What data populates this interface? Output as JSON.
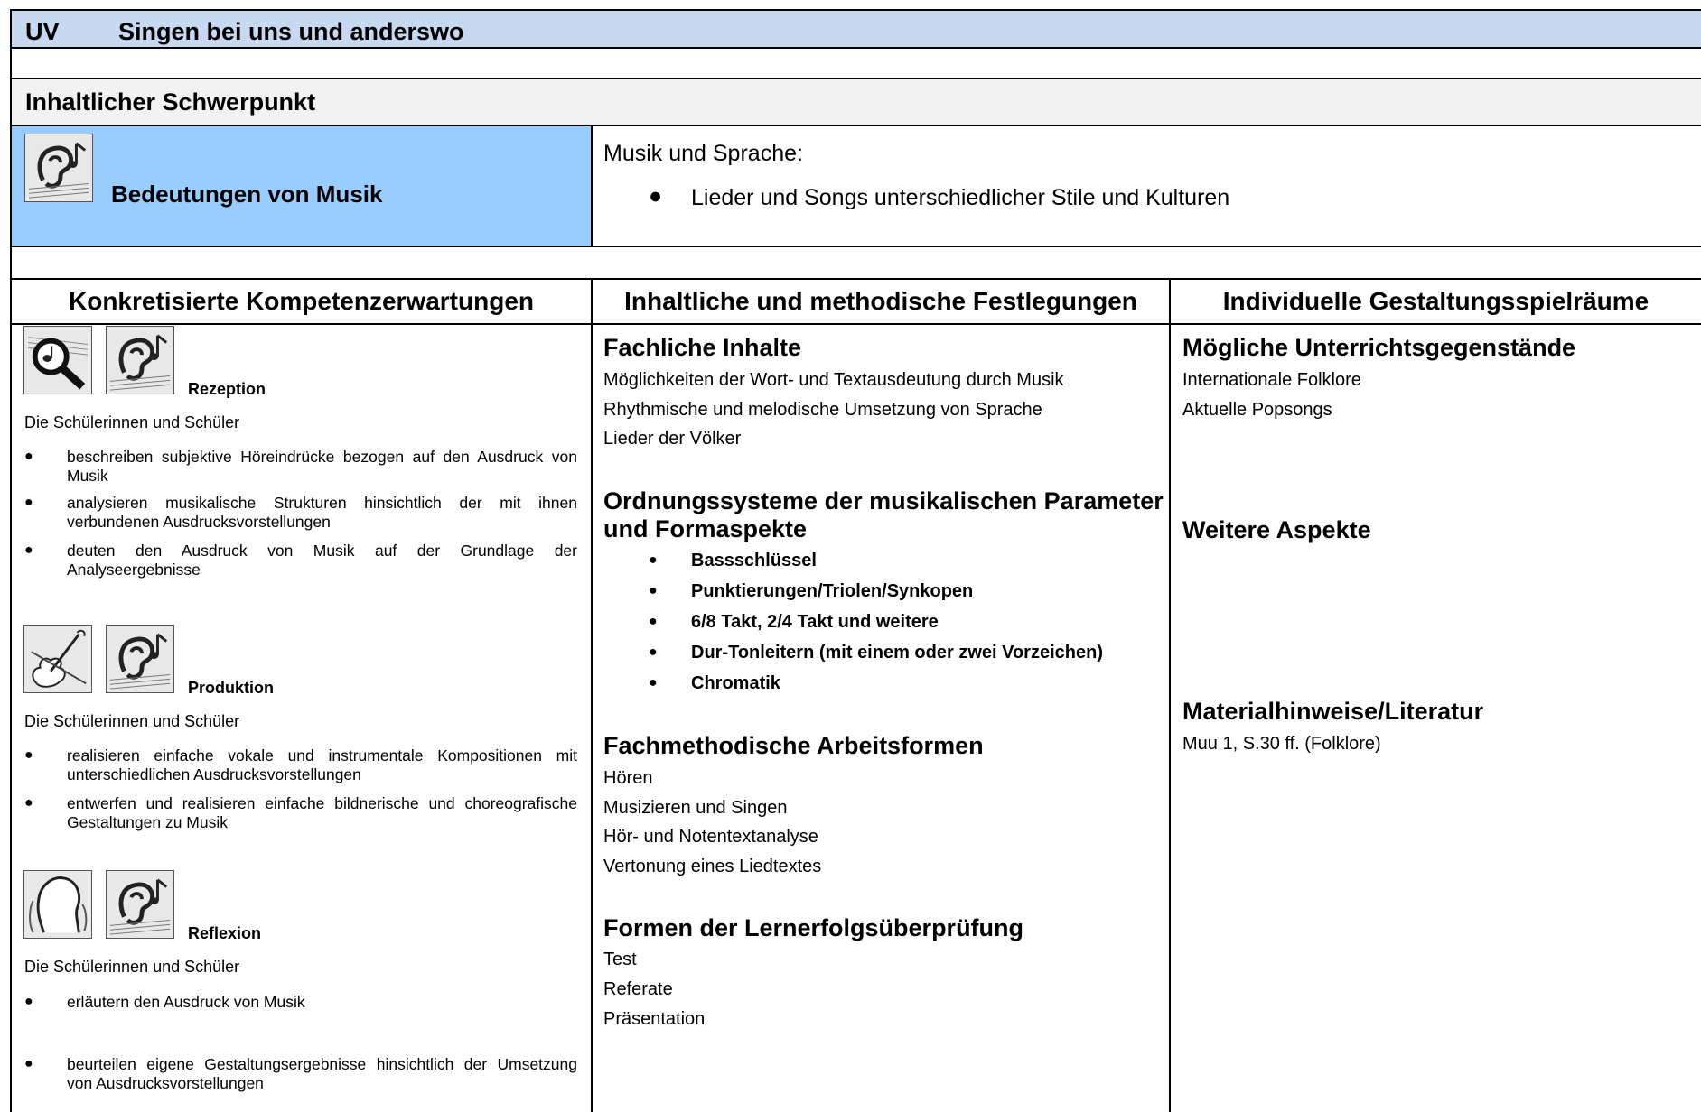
{
  "header": {
    "uv": "UV",
    "title": "Singen bei uns und anderswo"
  },
  "schwerpunkt": {
    "label": "Inhaltlicher Schwerpunkt",
    "field": "Bedeutungen von Musik",
    "content_title": "Musik und Sprache:",
    "content_items": [
      "Lieder und Songs unterschiedlicher Stile und Kulturen"
    ]
  },
  "columns": {
    "col1": "Konkretisierte Kompetenzerwartungen",
    "col2": "Inhaltliche und methodische Festlegungen",
    "col3": "Individuelle Gestaltungsspielräume"
  },
  "competencies": [
    {
      "label": "Rezeption",
      "intro": "Die Schülerinnen und Schüler",
      "items": [
        "beschreiben subjektive Höreindrücke bezogen auf den Ausdruck von Musik",
        "analysieren musikalische Strukturen hinsichtlich der mit ihnen verbundenen Ausdrucksvorstellungen",
        "deuten den Ausdruck von Musik auf der Grundlage der Analyseergebnisse"
      ]
    },
    {
      "label": "Produktion",
      "intro": "Die Schülerinnen und Schüler",
      "items": [
        "realisieren einfache vokale und instrumentale Kompositionen mit unterschiedlichen Ausdrucksvorstellungen",
        "entwerfen und realisieren einfache bildnerische und choreografische Gestaltungen zu Musik"
      ]
    },
    {
      "label": "Reflexion",
      "intro": "Die Schülerinnen und Schüler",
      "items": [
        "erläutern den Ausdruck von Musik",
        "beurteilen eigene Gestaltungsergebnisse hinsichtlich der Umsetzung von Ausdrucksvorstellungen"
      ]
    }
  ],
  "festlegungen": {
    "fachliche_title": "Fachliche Inhalte",
    "fachliche_items": [
      "Möglichkeiten der Wort- und Textausdeutung durch Musik",
      "Rhythmische und melodische Umsetzung von Sprache",
      "Lieder der Völker"
    ],
    "ordnung_title_1": "Ordnungssysteme der musikalischen Parameter",
    "ordnung_title_2": "und  Formaspekte",
    "ordnung_items": [
      "Bassschlüssel",
      "Punktierungen/Triolen/Synkopen",
      "6/8 Takt, 2/4 Takt und weitere",
      "Dur-Tonleitern (mit einem oder zwei Vorzeichen)",
      "Chromatik"
    ],
    "methoden_title": "Fachmethodische Arbeitsformen",
    "methoden_items": [
      "Hören",
      "Musizieren und Singen",
      "Hör- und Notentextanalyse",
      "Vertonung eines Liedtextes"
    ],
    "lernerfolg_title": "Formen der Lernerfolgsüberprüfung",
    "lernerfolg_items": [
      "Test",
      "Referate",
      "Präsentation"
    ]
  },
  "spielraeume": {
    "gegenstaende_title": "Mögliche Unterrichtsgegenstände",
    "gegenstaende_items": [
      "Internationale Folklore",
      "Aktuelle Popsongs"
    ],
    "weitere_title": "Weitere Aspekte",
    "material_title": "Materialhinweise/Literatur",
    "material_items": [
      "Muu 1, S.30 ff. (Folklore)"
    ]
  },
  "icons": [
    "ear-music-icon",
    "magnifier-music-icon",
    "violin-icon",
    "head-silhouette-icon"
  ]
}
